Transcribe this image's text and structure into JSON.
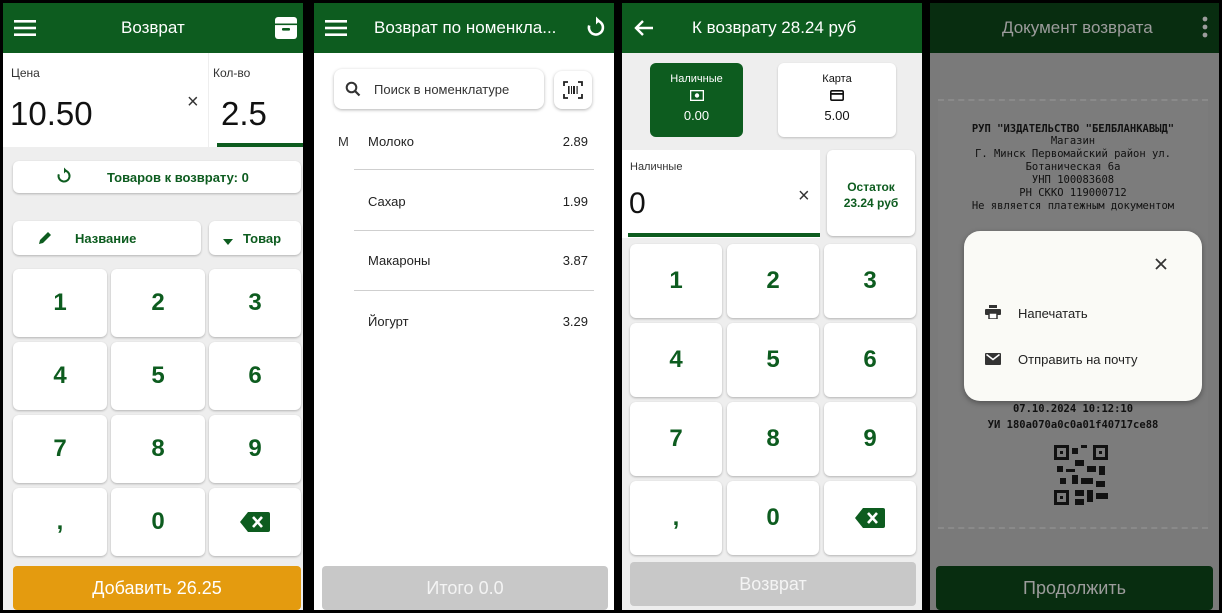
{
  "s1": {
    "title": "Возврат",
    "price_label": "Цена",
    "price_value": "10.50",
    "qty_label": "Кол-во",
    "qty_value": "2.5",
    "return_items": "Товаров к возврату: 0",
    "name_btn": "Название",
    "goods_btn": "Товар",
    "keys": [
      "1",
      "2",
      "3",
      "4",
      "5",
      "6",
      "7",
      "8",
      "9",
      ",",
      "0"
    ],
    "add_btn": "Добавить 26.25"
  },
  "s2": {
    "title": "Возврат по номенкла...",
    "search_placeholder": "Поиск в номенклатуре",
    "group_letter": "М",
    "items": [
      {
        "name": "Молоко",
        "price": "2.89"
      },
      {
        "name": "Сахар",
        "price": "1.99"
      },
      {
        "name": "Макароны",
        "price": "3.87"
      },
      {
        "name": "Йогурт",
        "price": "3.29"
      }
    ],
    "total_btn": "Итого 0.0"
  },
  "s3": {
    "title": "К возврату 28.24 руб",
    "cash_label": "Наличные",
    "cash_value": "0.00",
    "card_label": "Карта",
    "card_value": "5.00",
    "input_label": "Наличные",
    "input_value": "0",
    "rest_label": "Остаток",
    "rest_value": "23.24 руб",
    "keys": [
      "1",
      "2",
      "3",
      "4",
      "5",
      "6",
      "7",
      "8",
      "9",
      ",",
      "0"
    ],
    "return_btn": "Возврат"
  },
  "s4": {
    "title": "Документ возврата",
    "receipt_lines": [
      "РУП \"ИЗДАТЕЛЬСТВО \"БЕЛБЛАНКАВЫД\"",
      "Магазин",
      "Г. Минск Первомайский район ул.",
      "Ботаническая 6а",
      "УНП 100083608",
      "РН СККО 119000712",
      "Не является платежным документом"
    ],
    "receipt_date": "07.10.2024 10:12:10",
    "receipt_ui": "УИ 180a070a0c0a01f40717ce88",
    "menu_print": "Напечатать",
    "menu_email": "Отправить на почту",
    "continue_btn": "Продолжить"
  },
  "colors": {
    "primary": "#0d5c1f",
    "accent": "#e49b0f",
    "disabled": "#c8c8c8"
  }
}
